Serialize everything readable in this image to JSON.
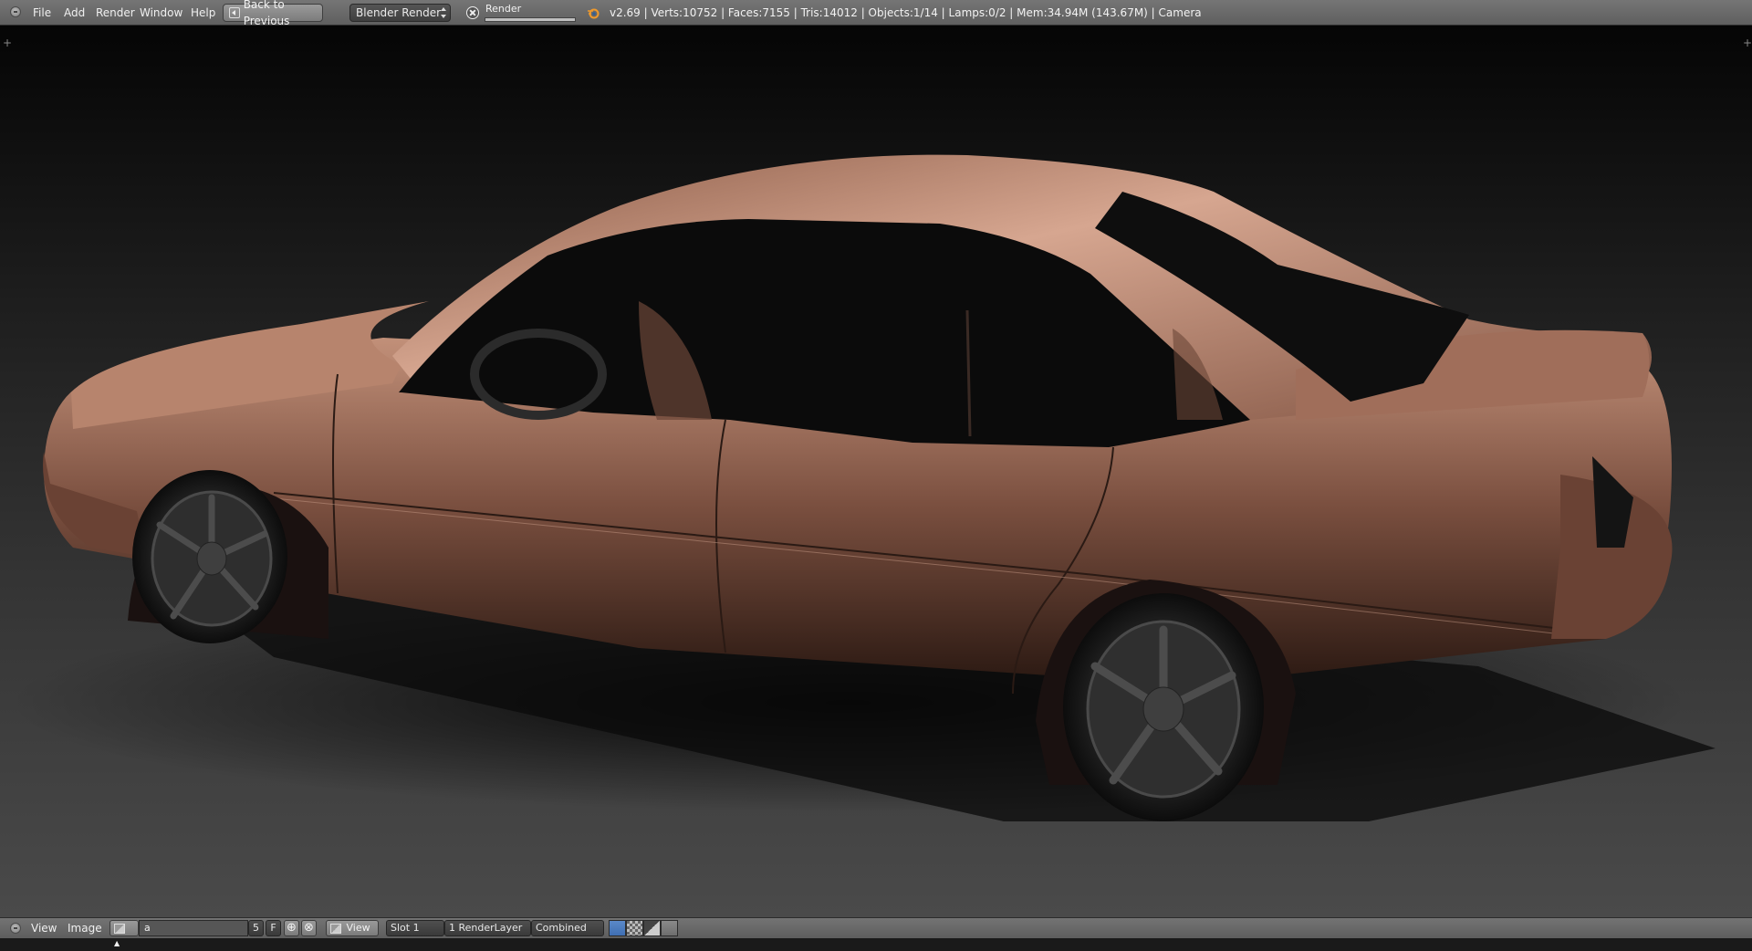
{
  "info_header": {
    "menus": [
      "File",
      "Add",
      "Render",
      "Window",
      "Help"
    ],
    "back_button": "Back to Previous",
    "render_engine": "Blender Render",
    "render_progress": {
      "label": "Render",
      "fraction": 1.0
    },
    "stats": "v2.69 | Verts:10752 | Faces:7155 | Tris:14012 | Objects:1/14 | Lamps:0/2 | Mem:34.94M (143.67M) | Camera"
  },
  "image_editor_header": {
    "menus": [
      "View",
      "Image"
    ],
    "image_name": "a",
    "user_count": "5",
    "fake_user": "F",
    "view_select": "View",
    "slot_select": "Slot 1",
    "render_layer_select": "1 RenderLayer",
    "pass_select": "Combined",
    "draw_modes": [
      "color-alpha-icon",
      "alpha-icon",
      "z-buffer-icon",
      "display-options-icon"
    ]
  },
  "colors": {
    "header_top": "#757575",
    "header_bottom": "#5f5f5f",
    "car_paint_light": "#cf9c86",
    "car_paint_dark": "#7a4d3c",
    "active_toggle": "#4a7abf"
  }
}
